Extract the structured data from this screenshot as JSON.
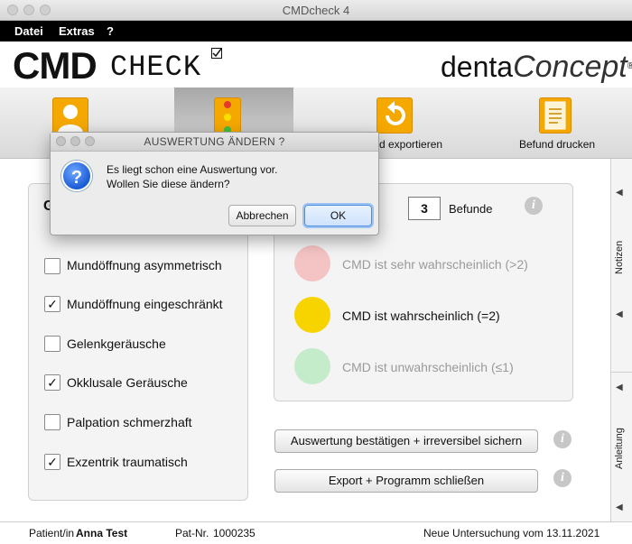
{
  "window": {
    "title": "CMDcheck 4"
  },
  "menu": [
    "Datei",
    "Extras",
    "?"
  ],
  "logo": {
    "cmd": "CMD",
    "check": "CHECK",
    "brand_left": "denta",
    "brand_right": "Concept"
  },
  "toolbar": {
    "items": [
      {
        "label": "",
        "icon": "user-icon"
      },
      {
        "label": "",
        "icon": "traffic-light-icon"
      },
      {
        "label": "d exportieren",
        "icon": "export-icon"
      },
      {
        "label": "Befund drucken",
        "icon": "print-document-icon"
      }
    ]
  },
  "sidebar": {
    "notizen": "Notizen",
    "anleitung": "Anleitung"
  },
  "checklist": {
    "heading_fragment": "G",
    "items": [
      {
        "label": "Mundöffnung asymmetrisch",
        "checked": false
      },
      {
        "label": "Mundöffnung eingeschränkt",
        "checked": true
      },
      {
        "label": "Gelenkgeräusche",
        "checked": false
      },
      {
        "label": "Okklusale Geräusche",
        "checked": true
      },
      {
        "label": "Palpation schmerzhaft",
        "checked": false
      },
      {
        "label": "Exzentrik traumatisch",
        "checked": true
      }
    ]
  },
  "result": {
    "count": "3",
    "count_label": "Befunde",
    "levels": [
      {
        "label": "CMD ist sehr wahrscheinlich (>2)",
        "color": "#f4c4c4",
        "active": false
      },
      {
        "label": "CMD ist wahrscheinlich (=2)",
        "color": "#f7d400",
        "active": true
      },
      {
        "label": "CMD ist unwahrscheinlich (≤1)",
        "color": "#c4eccb",
        "active": false
      }
    ]
  },
  "actions": {
    "confirm": "Auswertung bestätigen + irreversibel sichern",
    "export_close": "Export + Programm schließen"
  },
  "status": {
    "patient_label": "Patient/in",
    "patient_name": "Anna Test",
    "patnr_label": "Pat-Nr.",
    "patnr": "1000235",
    "exam": "Neue Untersuchung vom 13.11.2021"
  },
  "dialog": {
    "title": "AUSWERTUNG ÄNDERN ?",
    "line1": "Es liegt schon eine Auswertung vor.",
    "line2": "Wollen Sie diese ändern?",
    "cancel": "Abbrechen",
    "ok": "OK"
  },
  "colors": {
    "accent_icon": "#f5a800",
    "menubar": "#000000",
    "ok_focus": "#4e8de0"
  }
}
